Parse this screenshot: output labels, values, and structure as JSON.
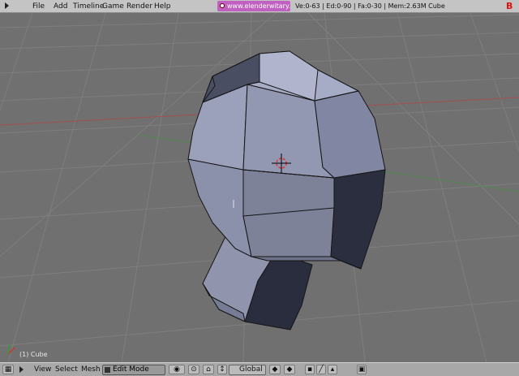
{
  "menubar": {
    "items": [
      "File",
      "Add",
      "Timeline",
      "Game",
      "Render",
      "Help"
    ],
    "screen_name": "www.elenderwitary.SCR",
    "stats": "Ve:0-63 | Ed:0-90 | Fa:0-30 | Mem:2.63M Cube",
    "logo": "B"
  },
  "viewport": {
    "object_label": "(1) Cube"
  },
  "header": {
    "menus": [
      "View",
      "Select",
      "Mesh"
    ],
    "mode": "Edit Mode",
    "pivot": "Global"
  },
  "colors": {
    "menubar_bg": "#c4c4c4",
    "viewport_bg": "#707070",
    "mesh_face": "#8a8fa8",
    "mesh_edge": "#141414",
    "screen_field": "#c060c0"
  }
}
